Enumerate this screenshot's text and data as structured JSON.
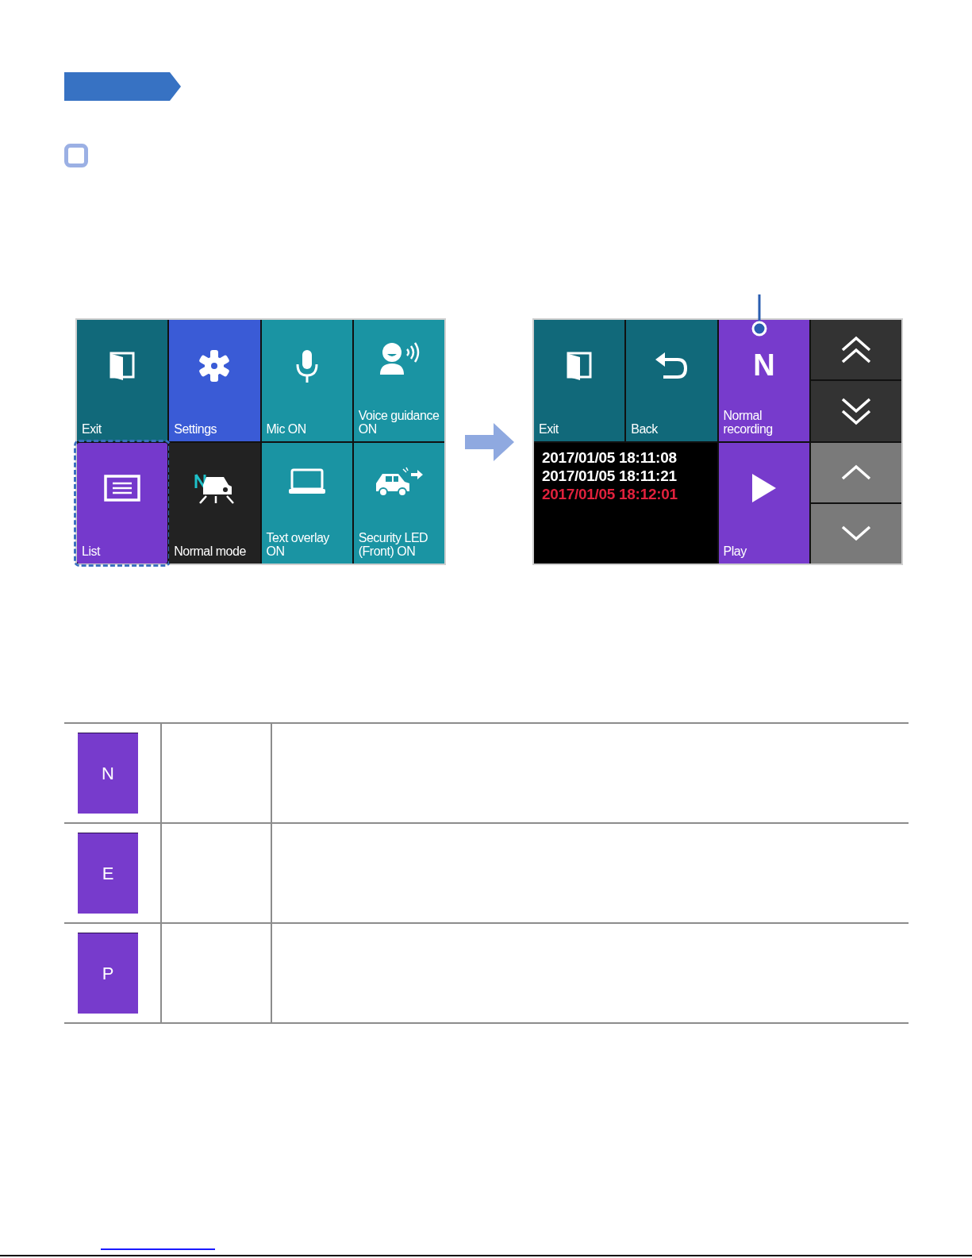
{
  "menu_screen": {
    "tiles": [
      {
        "kind": "exit",
        "label": "Exit",
        "color": "#11697a",
        "selected": false
      },
      {
        "kind": "settings",
        "label": "Settings",
        "color": "#3a5bd6",
        "selected": false
      },
      {
        "kind": "mic",
        "label": "Mic ON",
        "color": "#1a94a3",
        "selected": false
      },
      {
        "kind": "voice",
        "label": "Voice guidance ON",
        "color": "#1a94a3",
        "selected": false
      },
      {
        "kind": "list",
        "label": "List",
        "color": "#7539cc",
        "selected": true
      },
      {
        "kind": "mode",
        "label": "Normal mode",
        "color": "#222222",
        "selected": false
      },
      {
        "kind": "overlay",
        "label": "Text overlay ON",
        "color": "#1a94a3",
        "selected": false
      },
      {
        "kind": "led",
        "label": "Security LED (Front) ON",
        "color": "#1a94a3",
        "selected": false
      }
    ]
  },
  "list_screen": {
    "exit": {
      "label": "Exit"
    },
    "back": {
      "label": "Back"
    },
    "recording": {
      "glyph": "N",
      "label": "Normal recording"
    },
    "files": [
      {
        "text": "2017/01/05 18:11:08",
        "color": "#ffffff"
      },
      {
        "text": "2017/01/05 18:11:21",
        "color": "#ffffff"
      },
      {
        "text": "2017/01/05 18:12:01",
        "color": "#e0213c"
      }
    ],
    "play": {
      "label": "Play"
    },
    "nav": [
      {
        "kind": "page-up",
        "color": "#333333"
      },
      {
        "kind": "page-down",
        "color": "#333333"
      },
      {
        "kind": "up",
        "color": "#7a7a7a"
      },
      {
        "kind": "down",
        "color": "#7a7a7a"
      }
    ]
  },
  "legend": [
    {
      "badge": "N"
    },
    {
      "badge": "E"
    },
    {
      "badge": "P"
    }
  ]
}
